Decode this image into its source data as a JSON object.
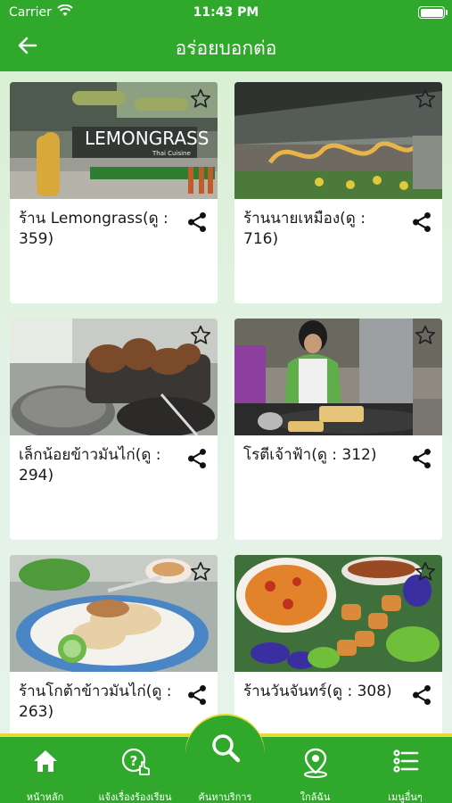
{
  "status_bar": {
    "carrier": "Carrier",
    "time": "11:43 PM"
  },
  "header": {
    "title": "อร่อยบอกต่อ"
  },
  "restaurants": [
    {
      "name": "ร้าน Lemongrass(ดู : 359)",
      "thumb_label": "LEMONGRASS",
      "thumb_sub": "Thai Cuisine"
    },
    {
      "name": "ร้านนายเหมือง(ดู : 716)"
    },
    {
      "name": "เล็กน้อยข้าวมันไก่(ดู : 294)"
    },
    {
      "name": "โรตีเจ้าฟ้า(ดู : 312)"
    },
    {
      "name": "ร้านโกต้าข้าวมันไก่(ดู : 263)"
    },
    {
      "name": "ร้านวันจันทร์(ดู : 308)"
    }
  ],
  "tabs": [
    {
      "label": "หน้าหลัก",
      "icon": "home-icon"
    },
    {
      "label": "แจ้งเรื่องร้องเรียน",
      "icon": "help-icon"
    },
    {
      "label": "ค้นหาบริการ",
      "icon": "search-icon"
    },
    {
      "label": "ใกล้ฉัน",
      "icon": "location-pin-icon"
    },
    {
      "label": "เมนูอื่นๆ",
      "icon": "menu-list-icon"
    }
  ],
  "colors": {
    "primary": "#2fa82c",
    "accent": "#e8d93a"
  }
}
